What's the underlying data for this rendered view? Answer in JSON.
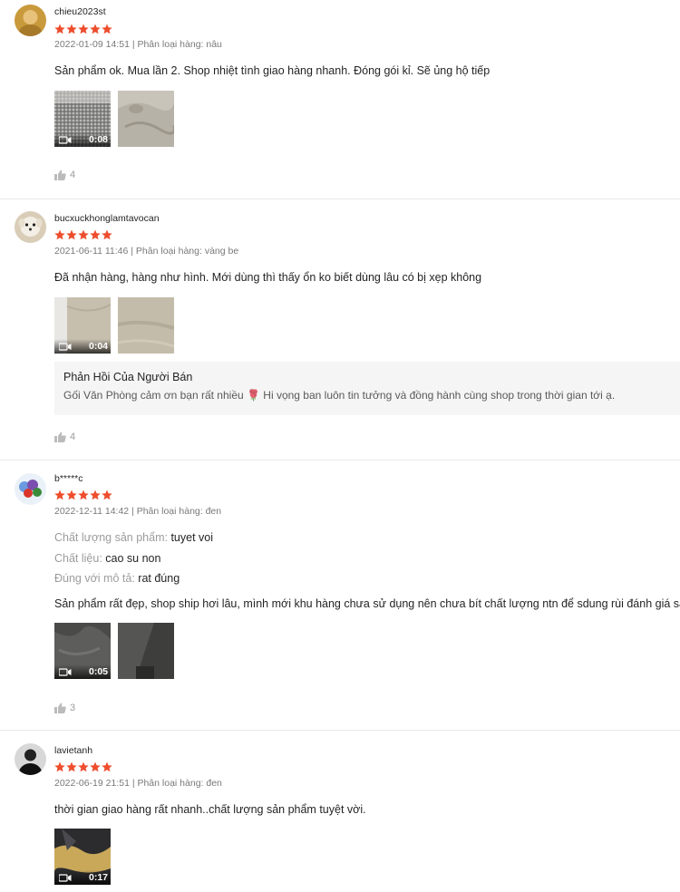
{
  "colors": {
    "star": "#ee4d2d",
    "bg_reply": "#f5f5f5"
  },
  "reviews": [
    {
      "username": "chieu2023st",
      "rating": 5,
      "date": "2022-01-09 14:51",
      "variation_label": "Phân loại hàng: nâu",
      "text": "Sản phẩm ok. Mua lần 2. Shop nhiệt tình giao hàng nhanh. Đóng gói kỉ. Sẽ ủng hộ tiếp",
      "media": [
        {
          "type": "video",
          "duration": "0:08"
        },
        {
          "type": "image"
        }
      ],
      "likes": "4"
    },
    {
      "username": "bucxuckhonglamtavocan",
      "rating": 5,
      "date": "2021-06-11 11:46",
      "variation_label": "Phân loại hàng: vàng be",
      "text": "Đã nhận hàng, hàng như hình. Mới dùng thì thấy ổn ko biết dùng lâu có bị xẹp không",
      "media": [
        {
          "type": "video",
          "duration": "0:04"
        },
        {
          "type": "image"
        }
      ],
      "seller_reply": {
        "title": "Phản Hồi Của Người Bán",
        "body": "Gối Văn Phòng cảm ơn bạn rất nhiều 🌹 Hi vọng ban luôn tin tưởng và đồng hành cùng shop trong thời gian tới ạ."
      },
      "likes": "4"
    },
    {
      "username": "b*****c",
      "rating": 5,
      "date": "2022-12-11 14:42",
      "variation_label": "Phân loại hàng: đen",
      "attributes": [
        {
          "key": "Chất lượng sản phẩm:",
          "value": "tuyet voi"
        },
        {
          "key": "Chất liệu:",
          "value": "cao su non"
        },
        {
          "key": "Đúng với mô tả:",
          "value": "rat đúng"
        }
      ],
      "text": "Sản phẩm rất đẹp, shop ship hơi lâu, mình mới khu hàng chưa sử dụng nên chưa bít chất lượng ntn để sdung rùi đánh giá sau.",
      "media": [
        {
          "type": "video",
          "duration": "0:05"
        },
        {
          "type": "image"
        }
      ],
      "likes": "3"
    },
    {
      "username": "lavietanh",
      "rating": 5,
      "date": "2022-06-19 21:51",
      "variation_label": "Phân loại hàng: đen",
      "text": "thời gian giao hàng rất nhanh..chất lượng sản phẩm tuyệt vời.",
      "media": [
        {
          "type": "video",
          "duration": "0:17"
        }
      ]
    }
  ]
}
